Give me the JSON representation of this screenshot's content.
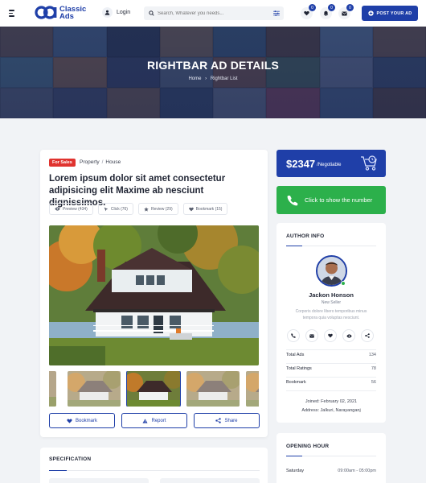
{
  "header": {
    "logo_line1": "Classic",
    "logo_line2": "Ads",
    "login_label": "Login",
    "search_placeholder": "Search, Whatever you needs...",
    "badges": {
      "favorites": "0",
      "notifications": "0",
      "messages": "0"
    },
    "post_button": "POST YOUR AD",
    "brand_color": "#1f3fa8"
  },
  "banner": {
    "title": "RIGHTBAR AD DETAILS",
    "breadcrumb": {
      "home": "Home",
      "current": "Rightbar List"
    }
  },
  "ad": {
    "sale_tag": "For Sales",
    "category": "Property",
    "subcategory": "House",
    "title": "Lorem ipsum dolor sit amet consectetur adipisicing elit Maxime ab nesciunt dignissimos.",
    "stats": {
      "preview": "Preview (434)",
      "click": "Click (76)",
      "review": "Review (29)",
      "bookmark": "Bookmark (15)"
    },
    "actions": {
      "bookmark": "Bookmark",
      "report": "Report",
      "share": "Share"
    }
  },
  "specification": {
    "title": "SPECIFICATION"
  },
  "price": {
    "amount": "$2347",
    "note": "/Negotiable"
  },
  "call": {
    "label": "Click to show the number"
  },
  "author": {
    "section_title": "AUTHOR INFO",
    "name": "Jackon Honson",
    "role": "New Seller",
    "description": "Corporis dolore libero temporibus minus tempora quia voluptas nesciunt.",
    "stats": [
      {
        "label": "Total Ads",
        "value": "134"
      },
      {
        "label": "Total Ratings",
        "value": "78"
      },
      {
        "label": "Bookmark",
        "value": "56"
      }
    ],
    "joined": "Joined: February 02, 2021",
    "address": "Address: Jalkuri, Narayanganj"
  },
  "opening": {
    "title": "OPENING HOUR",
    "day": "Saturday",
    "hours": "09:00am - 05:00pm"
  }
}
